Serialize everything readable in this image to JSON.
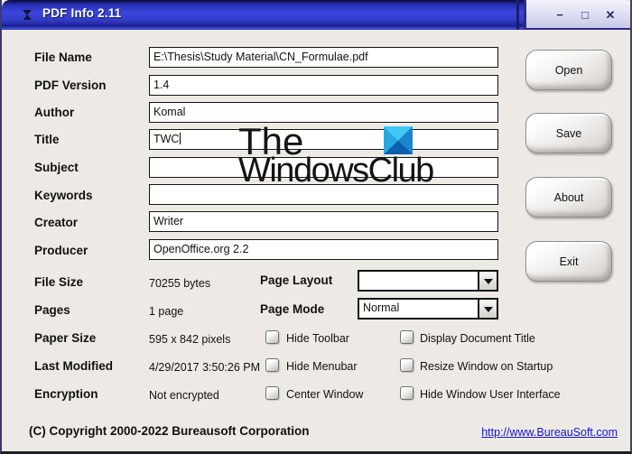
{
  "window": {
    "title": "PDF Info 2.11",
    "controls": {
      "minimize": "−",
      "maximize": "□",
      "close": "✕"
    }
  },
  "fields": [
    {
      "label": "File Name",
      "value": "E:\\Thesis\\Study Material\\CN_Formulae.pdf"
    },
    {
      "label": "PDF Version",
      "value": "1.4"
    },
    {
      "label": "Author",
      "value": "Komal"
    },
    {
      "label": "Title",
      "value": "TWC"
    },
    {
      "label": "Subject",
      "value": ""
    },
    {
      "label": "Keywords",
      "value": ""
    },
    {
      "label": "Creator",
      "value": "Writer"
    },
    {
      "label": "Producer",
      "value": "OpenOffice.org 2.2"
    }
  ],
  "info": [
    {
      "label": "File Size",
      "value": "70255 bytes"
    },
    {
      "label": "Pages",
      "value": "1 page"
    },
    {
      "label": "Paper Size",
      "value": "595 x 842 pixels"
    },
    {
      "label": "Last Modified",
      "value": "4/29/2017 3:50:26 PM"
    },
    {
      "label": "Encryption",
      "value": "Not encrypted"
    }
  ],
  "combos": [
    {
      "label": "Page Layout",
      "value": ""
    },
    {
      "label": "Page Mode",
      "value": "Normal"
    }
  ],
  "checkboxes": {
    "col1": [
      "Hide Toolbar",
      "Hide Menubar",
      "Center Window"
    ],
    "col2": [
      "Display Document Title",
      "Resize Window on Startup",
      "Hide Window User Interface"
    ]
  },
  "buttons": {
    "open": "Open",
    "save": "Save",
    "about": "About",
    "exit": "Exit"
  },
  "footer": {
    "copyright": "(C) Copyright 2000-2022 Bureausoft Corporation",
    "link": "http://www.BureauSoft.com"
  },
  "watermark": {
    "line1": "The",
    "line2": "WindowsClub"
  },
  "colors": {
    "titlebar_blue": "#3a46dd",
    "panel_lavender": "#dcdcf2",
    "body_gray": "#edeae5",
    "link_blue": "#1414cc",
    "logo_light": "#3ec9f6",
    "logo_dark": "#0b5fb0"
  }
}
